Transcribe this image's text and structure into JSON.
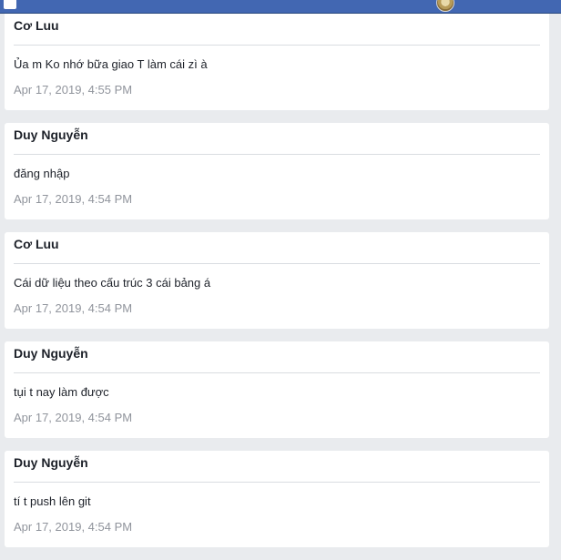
{
  "colors": {
    "header": "#4267b2",
    "background": "#e9ebee",
    "card": "#ffffff",
    "text": "#1d2129",
    "muted": "#90949c"
  },
  "icons": {
    "logo": "facebook-logo-icon",
    "profile": "profile-avatar-icon"
  },
  "posts": [
    {
      "author": "Cơ Luu",
      "message": "Ủa m Ko nhớ bữa giao T làm cái zì à",
      "time": "Apr 17, 2019, 4:55 PM"
    },
    {
      "author": "Duy Nguyễn",
      "message": "đăng nhập",
      "time": "Apr 17, 2019, 4:54 PM"
    },
    {
      "author": "Cơ Luu",
      "message": "Cái dữ liệu theo cấu trúc 3 cái bảng á",
      "time": "Apr 17, 2019, 4:54 PM"
    },
    {
      "author": "Duy Nguyễn",
      "message": "tụi t nay làm được",
      "time": "Apr 17, 2019, 4:54 PM"
    },
    {
      "author": "Duy Nguyễn",
      "message": "tí t push lên git",
      "time": "Apr 17, 2019, 4:54 PM"
    }
  ]
}
